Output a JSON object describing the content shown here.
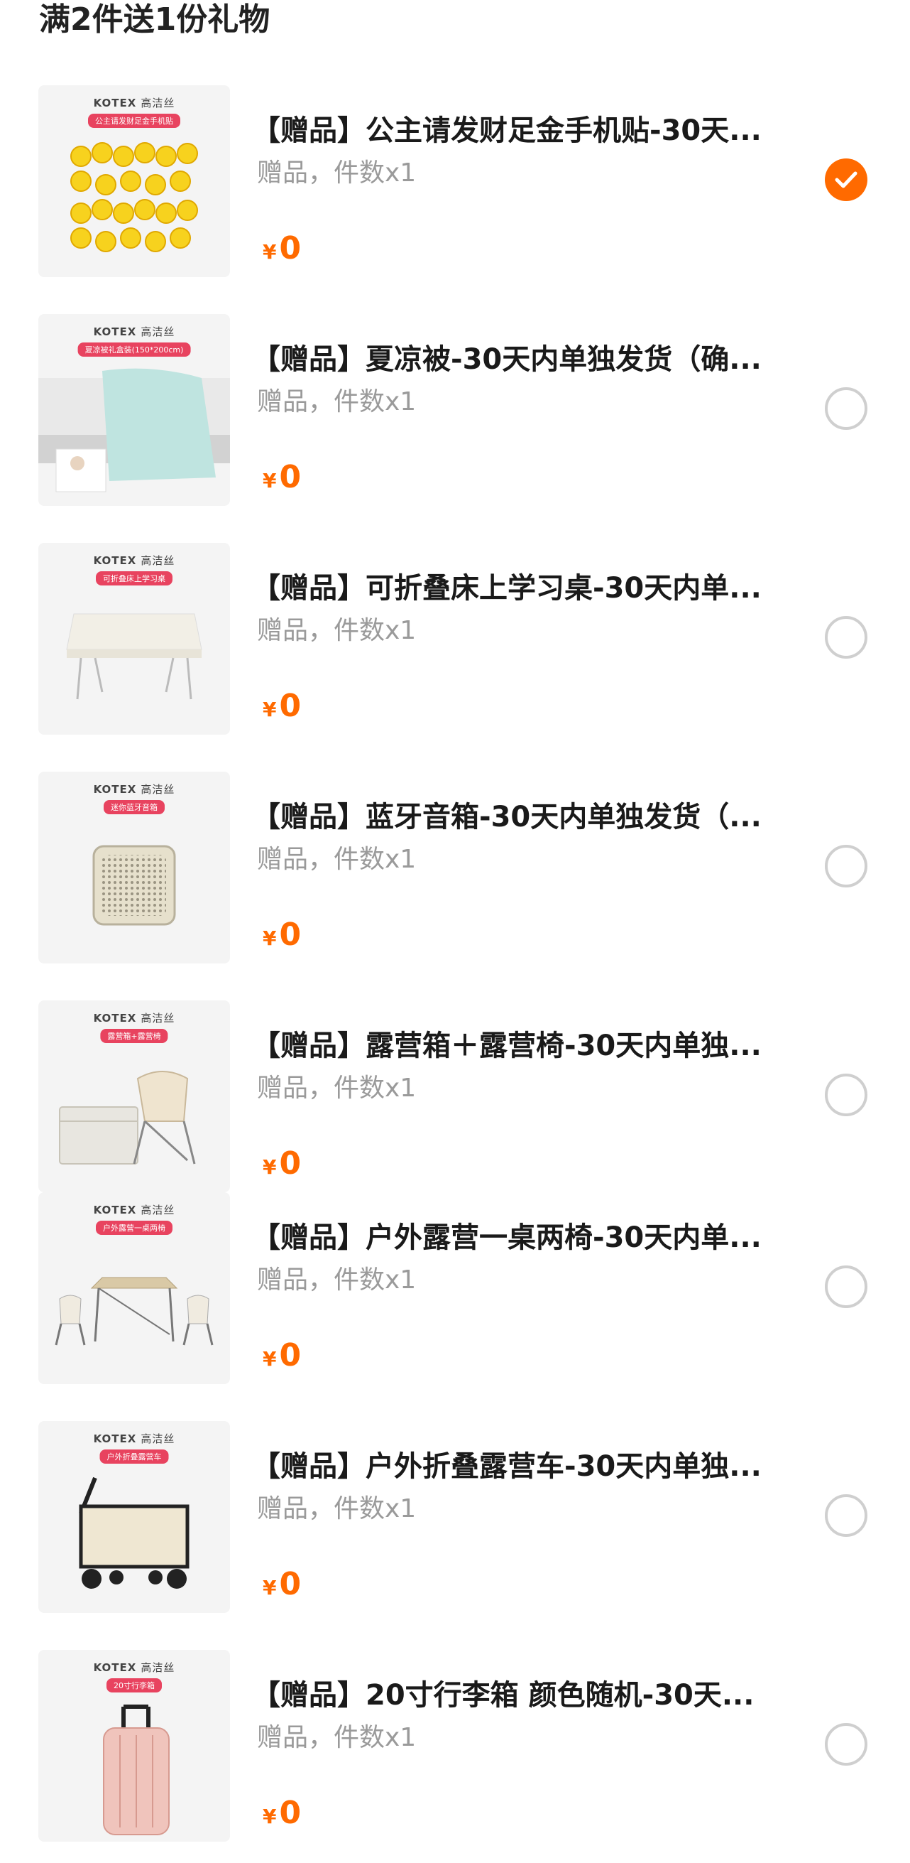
{
  "header": {
    "title": "满2件送1份礼物"
  },
  "items": [
    {
      "brand": "KOTEX",
      "brand_sub": "高洁丝",
      "tag": "公主请发财足金手机贴",
      "title": "【赠品】公主请发财足金手机贴-30天...",
      "sub": "赠品，件数x1",
      "currency": "¥",
      "price": "0",
      "selected": true,
      "icon": "phone-sticker-icon"
    },
    {
      "brand": "KOTEX",
      "brand_sub": "高洁丝",
      "tag": "夏凉被礼盒装(150*200cm)",
      "title": "【赠品】夏凉被-30天内单独发货（确...",
      "sub": "赠品，件数x1",
      "currency": "¥",
      "price": "0",
      "selected": false,
      "icon": "blanket-icon"
    },
    {
      "brand": "KOTEX",
      "brand_sub": "高洁丝",
      "tag": "可折叠床上学习桌",
      "title": "【赠品】可折叠床上学习桌-30天内单...",
      "sub": "赠品，件数x1",
      "currency": "¥",
      "price": "0",
      "selected": false,
      "icon": "desk-icon"
    },
    {
      "brand": "KOTEX",
      "brand_sub": "高洁丝",
      "tag": "迷你蓝牙音箱",
      "title": "【赠品】蓝牙音箱-30天内单独发货（...",
      "sub": "赠品，件数x1",
      "currency": "¥",
      "price": "0",
      "selected": false,
      "icon": "speaker-icon"
    },
    {
      "brand": "KOTEX",
      "brand_sub": "高洁丝",
      "tag": "露营箱+露营椅",
      "title": "【赠品】露营箱＋露营椅-30天内单独...",
      "sub": "赠品，件数x1",
      "currency": "¥",
      "price": "0",
      "selected": false,
      "icon": "camping-box-chair-icon"
    },
    {
      "brand": "KOTEX",
      "brand_sub": "高洁丝",
      "tag": "户外露营一桌两椅",
      "title": "【赠品】户外露营一桌两椅-30天内单...",
      "sub": "赠品，件数x1",
      "currency": "¥",
      "price": "0",
      "selected": false,
      "icon": "table-chairs-icon"
    },
    {
      "brand": "KOTEX",
      "brand_sub": "高洁丝",
      "tag": "户外折叠露营车",
      "title": "【赠品】户外折叠露营车-30天内单独...",
      "sub": "赠品，件数x1",
      "currency": "¥",
      "price": "0",
      "selected": false,
      "icon": "wagon-icon"
    },
    {
      "brand": "KOTEX",
      "brand_sub": "高洁丝",
      "tag": "20寸行李箱",
      "title": "【赠品】20寸行李箱 颜色随机-30天...",
      "sub": "赠品，件数x1",
      "currency": "¥",
      "price": "0",
      "selected": false,
      "icon": "suitcase-icon"
    }
  ],
  "colors": {
    "accent": "#ff6a00",
    "tag": "#e8435f",
    "muted": "#9a9a9a"
  }
}
